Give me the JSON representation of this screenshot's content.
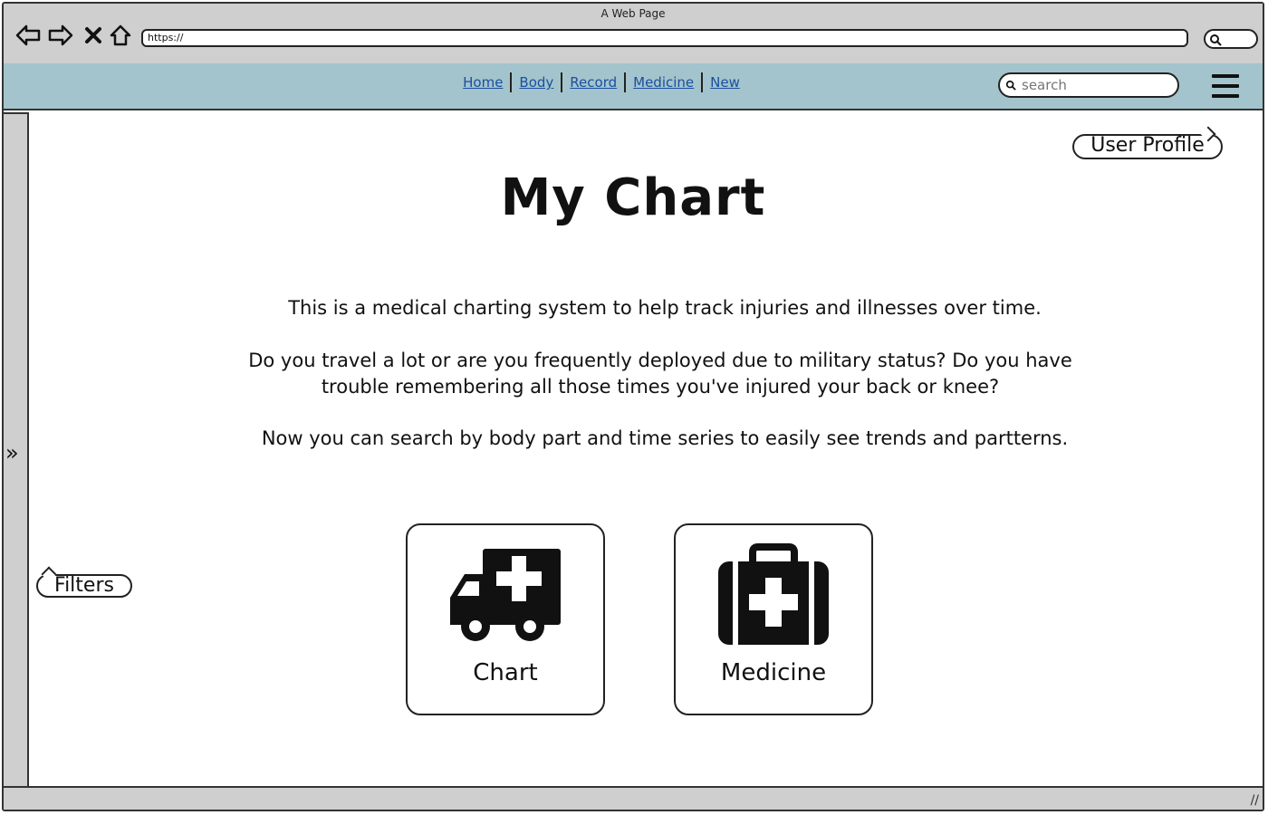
{
  "browser": {
    "title": "A Web Page",
    "url": "https://"
  },
  "navbar": {
    "links": [
      "Home",
      "Body",
      "Record",
      "Medicine",
      "New"
    ],
    "search_placeholder": "search"
  },
  "callouts": {
    "user_profile": "User Profile",
    "filters": "Filters"
  },
  "main": {
    "title": "My Chart",
    "paragraphs": [
      "This is a medical charting system to help track injuries and illnesses over time.",
      "Do you travel a lot or are you frequently deployed due to military status?  Do you have trouble remembering all those times you've injured your back or knee?",
      "Now you can search by body part and time series to easily see trends and partterns."
    ],
    "tiles": [
      {
        "label": "Chart",
        "icon": "ambulance-icon"
      },
      {
        "label": "Medicine",
        "icon": "medical-kit-icon"
      }
    ]
  },
  "icons": {
    "back": "back-arrow-icon",
    "forward": "forward-arrow-icon",
    "stop": "close-icon",
    "home": "home-icon",
    "menu": "hamburger-menu-icon",
    "sidebar_toggle": "double-chevron-right-icon"
  },
  "colors": {
    "navbar_bg": "#a3c4cc",
    "chrome_bg": "#cfcfcf",
    "link": "#1a4fa0"
  }
}
